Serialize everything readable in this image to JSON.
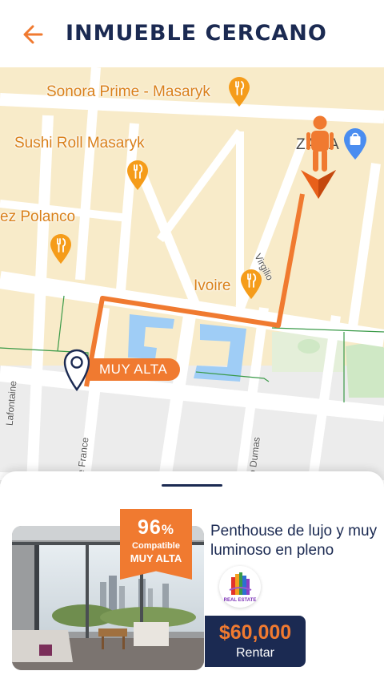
{
  "header": {
    "title": "INMUEBLE CERCANO",
    "back_icon": "arrow-left-icon",
    "accent_color": "#f07a30",
    "title_color": "#1b2a52"
  },
  "map": {
    "pois": [
      {
        "label": "Sonora Prime - Masaryk",
        "icon": "restaurant-icon"
      },
      {
        "label": "Sushi Roll Masaryk",
        "icon": "restaurant-icon"
      },
      {
        "label": "ez Polanco",
        "icon": "restaurant-icon"
      },
      {
        "label": "Ivoire",
        "icon": "restaurant-icon"
      }
    ],
    "store": {
      "label": "ZARA",
      "icon": "shopping-bag-icon"
    },
    "streets": [
      "Virgilio",
      "Lafontaine",
      "e France",
      "o Dumas"
    ],
    "property_badge": "MUY ALTA",
    "route_color": "#f07a30"
  },
  "listing": {
    "match_percent": "96",
    "match_percent_symbol": "%",
    "match_label": "Compatible",
    "match_level": "MUY ALTA",
    "title": "Penthouse de lujo y muy luminoso en pleno",
    "agency_logo_text": "REAL ESTATE",
    "price": "$60,000",
    "action": "Rentar"
  }
}
